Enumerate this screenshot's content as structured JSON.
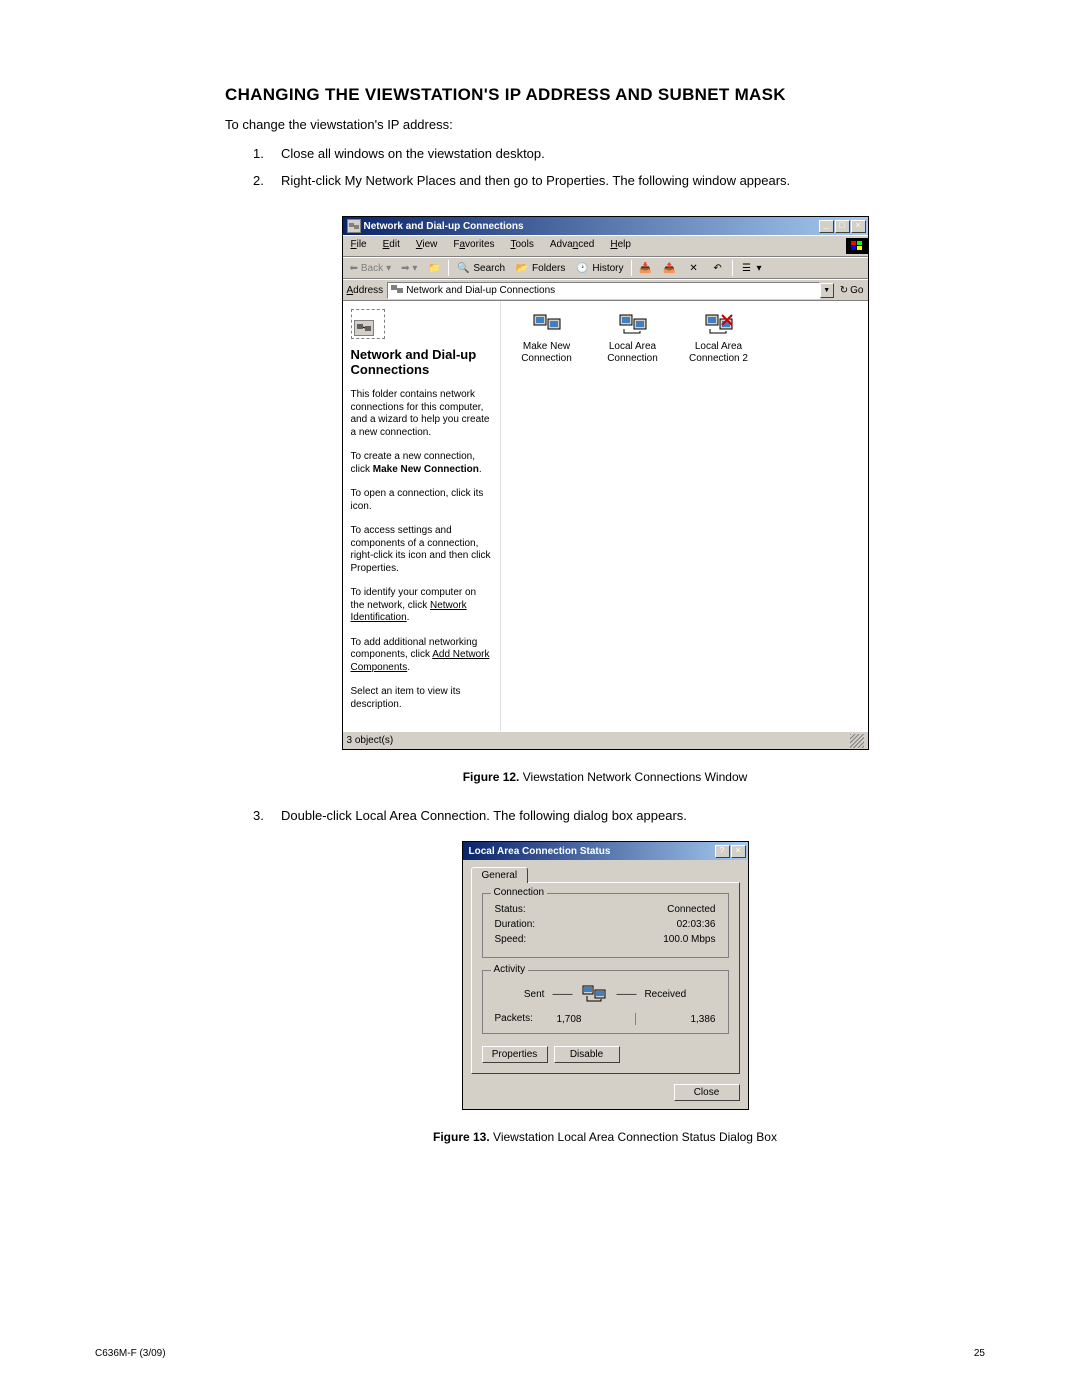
{
  "heading": "CHANGING THE VIEWSTATION'S IP ADDRESS AND SUBNET MASK",
  "intro": "To change the viewstation's IP address:",
  "steps": [
    "Close all windows on the viewstation desktop.",
    "Right-click My Network Places and then go to Properties. The following window appears.",
    "Double-click Local Area Connection. The following dialog box appears."
  ],
  "ncwin": {
    "title": "Network and Dial-up Connections",
    "menu": [
      "File",
      "Edit",
      "View",
      "Favorites",
      "Tools",
      "Advanced",
      "Help"
    ],
    "menu_underline_index": [
      0,
      0,
      0,
      1,
      0,
      1,
      0
    ],
    "toolbar": {
      "back": "Back",
      "search": "Search",
      "folders": "Folders",
      "history": "History"
    },
    "address_label": "Address",
    "address_text": "Network and Dial-up Connections",
    "go": "Go",
    "left": {
      "heading": "Network and Dial-up Connections",
      "p1": "This folder contains network connections for this computer, and a wizard to help you create a new connection.",
      "p2a": "To create a new connection, click ",
      "p2b": "Make New Connection",
      "p3": "To open a connection, click its icon.",
      "p4": "To access settings and components of a connection, right-click its icon and then click Properties.",
      "p5a": "To identify your computer on the network, click ",
      "p5b": "Network Identification",
      "p6a": "To add additional networking components, click ",
      "p6b": "Add Network Components",
      "p7": "Select an item to view its description."
    },
    "icons": [
      {
        "label1": "Make New",
        "label2": "Connection"
      },
      {
        "label1": "Local Area",
        "label2": "Connection"
      },
      {
        "label1": "Local Area",
        "label2": "Connection 2"
      }
    ],
    "status": "3 object(s)"
  },
  "figure12": {
    "label": "Figure 12.",
    "text": "Viewstation Network Connections Window"
  },
  "dialog": {
    "title": "Local Area Connection Status",
    "tab": "General",
    "connection": {
      "legend": "Connection",
      "status_lbl": "Status:",
      "status_val": "Connected",
      "duration_lbl": "Duration:",
      "duration_val": "02:03:36",
      "speed_lbl": "Speed:",
      "speed_val": "100.0 Mbps"
    },
    "activity": {
      "legend": "Activity",
      "sent": "Sent",
      "received": "Received",
      "packets_lbl": "Packets:",
      "sent_val": "1,708",
      "recv_val": "1,386"
    },
    "properties": "Properties",
    "disable": "Disable",
    "close": "Close"
  },
  "figure13": {
    "label": "Figure 13.",
    "text": "Viewstation Local Area Connection Status Dialog Box"
  },
  "footer": {
    "left": "C636M-F (3/09)",
    "right": "25"
  }
}
